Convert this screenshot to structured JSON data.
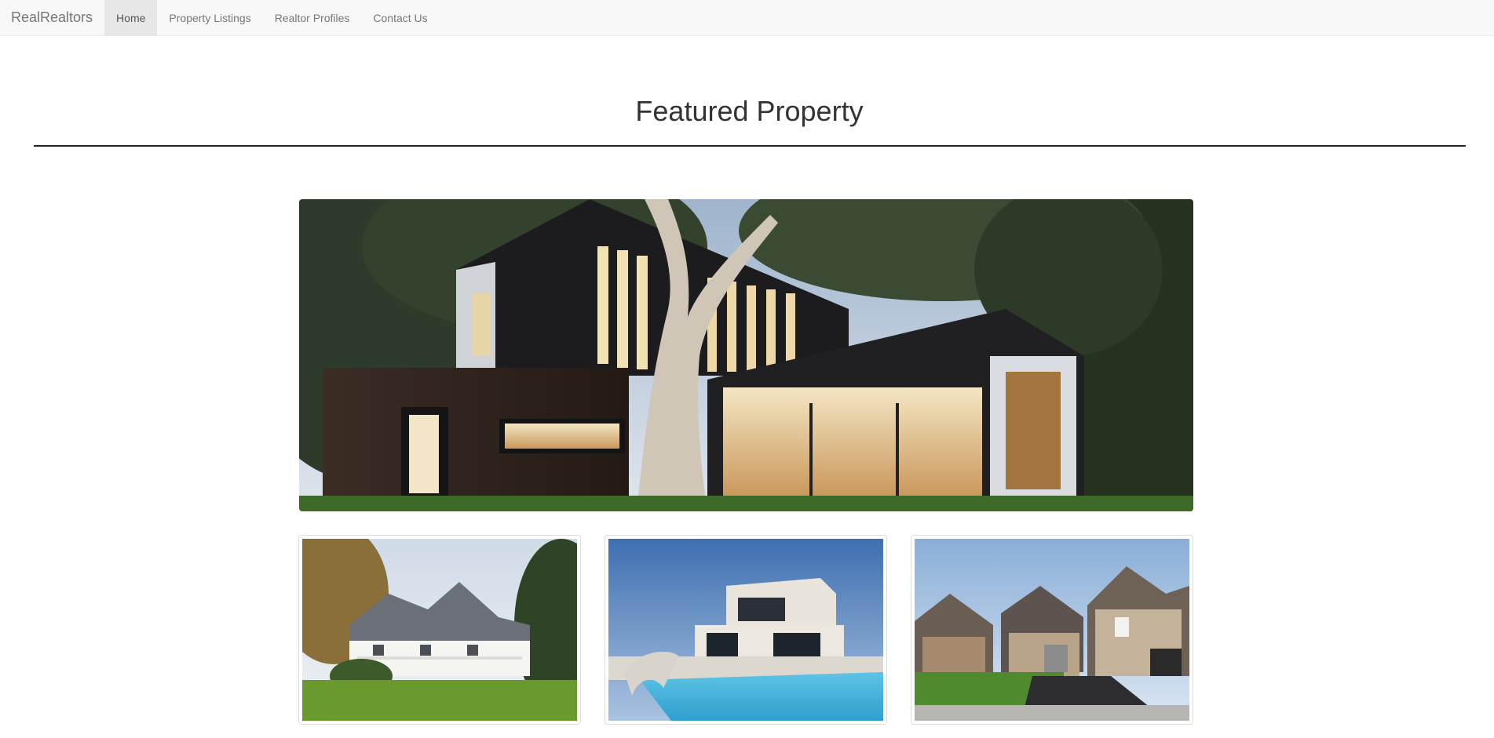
{
  "navbar": {
    "brand": "RealRealtors",
    "items": [
      {
        "label": "Home",
        "active": true
      },
      {
        "label": "Property Listings",
        "active": false
      },
      {
        "label": "Realtor Profiles",
        "active": false
      },
      {
        "label": "Contact Us",
        "active": false
      }
    ]
  },
  "main": {
    "heading": "Featured Property",
    "featured_image": "modern-house-photo",
    "thumbnails": [
      {
        "image": "white-colonial-house-photo"
      },
      {
        "image": "modern-villa-pool-photo"
      },
      {
        "image": "suburban-houses-photo"
      }
    ]
  },
  "colors": {
    "navbar_bg": "#f8f8f8",
    "nav_active_bg": "#e7e7e7",
    "nav_text": "#777777",
    "rule": "#222222"
  }
}
